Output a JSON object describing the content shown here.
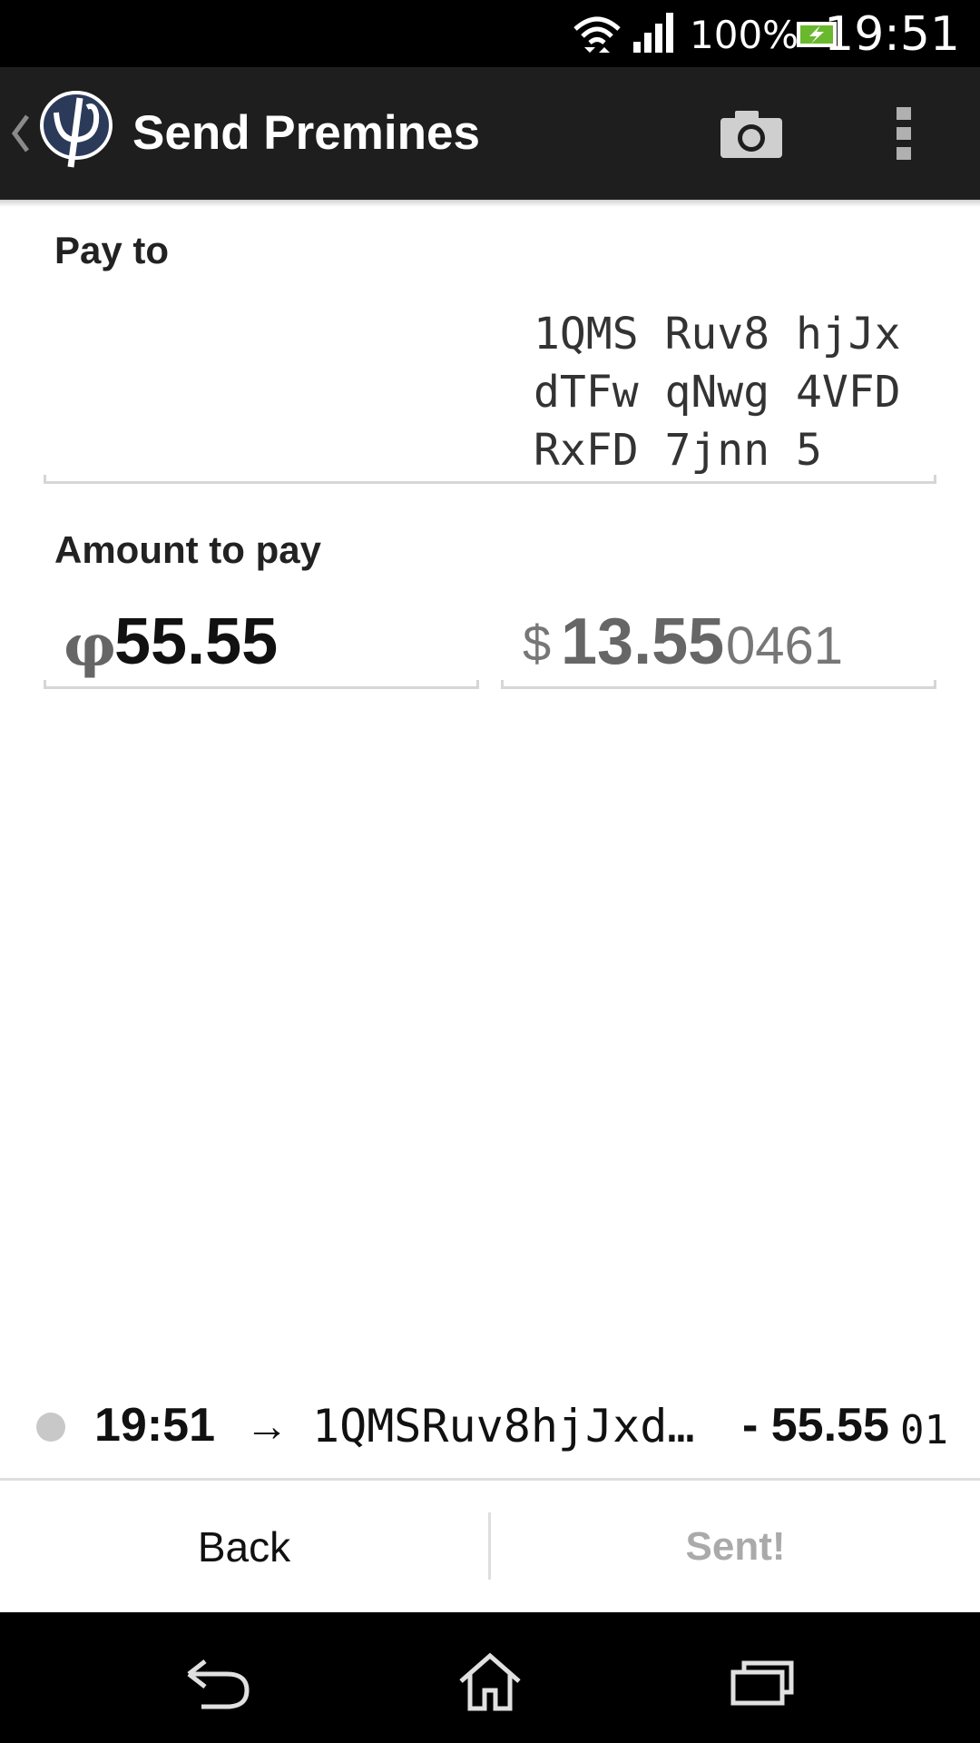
{
  "status_bar": {
    "battery_percent": "100%",
    "time": "19:51",
    "icons": [
      "wifi-icon",
      "signal-icon",
      "battery-charging-icon"
    ]
  },
  "action_bar": {
    "title": "Send Premines",
    "icons": [
      "back-chevron-icon",
      "app-logo-icon",
      "camera-icon",
      "overflow-menu-icon"
    ]
  },
  "pay_to": {
    "label": "Pay to",
    "address_lines": [
      "1QMS Ruv8 hjJx",
      "dTFw qNwg 4VFD",
      "RxFD 7jnn 5"
    ]
  },
  "amount": {
    "label": "Amount to pay",
    "coin_symbol": "φ",
    "coin_value": "55.55",
    "fiat_symbol": "$",
    "fiat_value_main": "13.55",
    "fiat_value_minor": "0461"
  },
  "transaction": {
    "time": "19:51",
    "arrow": "→",
    "address": "1QMSRuv8hjJxd…",
    "amount_main": "- 55.55",
    "amount_minor": "01"
  },
  "buttons": {
    "back_label": "Back",
    "sent_label": "Sent!"
  },
  "colors": {
    "action_bar": "#1e1e1e",
    "status_bar": "#000000",
    "disabled_text": "#aaaaaa"
  }
}
